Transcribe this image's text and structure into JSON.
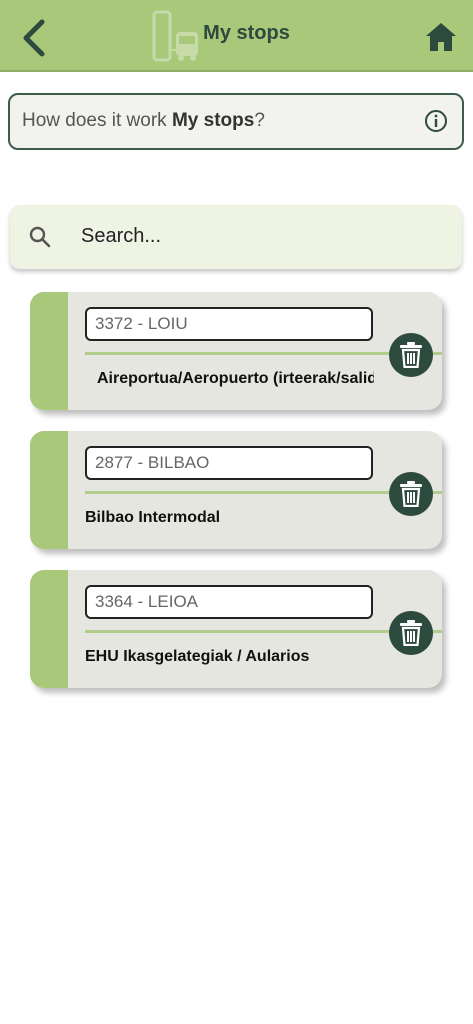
{
  "header": {
    "title": "My stops",
    "back_icon": "chevron-left-icon",
    "logo_icon": "bus-stop-icon",
    "home_icon": "home-icon",
    "background": "#a9c87a",
    "accent": "#2d4a3e"
  },
  "help": {
    "prefix": "How does it work ",
    "bold": "My stops",
    "suffix": "?",
    "icon": "info-icon"
  },
  "search": {
    "placeholder": "Search...",
    "icon": "search-icon"
  },
  "stops": [
    {
      "code": "3372 - LOIU",
      "name": "Aireportua/Aeropuerto (irteerak/salidas)"
    },
    {
      "code": "2877 - BILBAO",
      "name": "Bilbao Intermodal"
    },
    {
      "code": "3364 - LEIOA",
      "name": "EHU Ikasgelategiak / Aularios"
    }
  ]
}
